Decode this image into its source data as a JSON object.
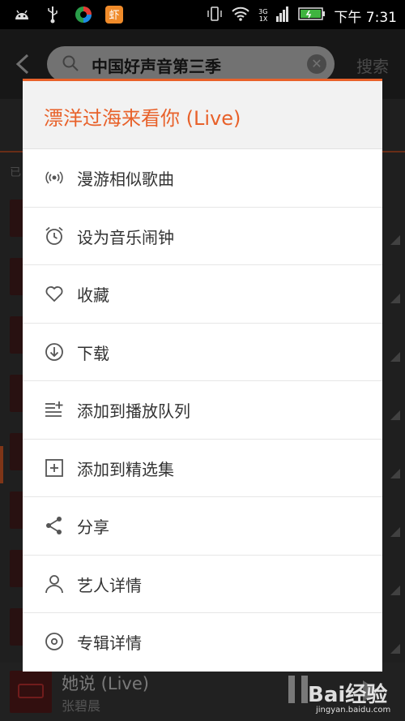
{
  "status_bar": {
    "time": "下午 7:31",
    "network_top": "3G",
    "network_bottom": "1X",
    "icons": [
      "android-icon",
      "usb-icon",
      "app-icon",
      "xiami-icon",
      "vibrate-icon",
      "wifi-icon",
      "signal-icon",
      "battery-icon"
    ]
  },
  "search": {
    "query": "中国好声音第三季",
    "button_label": "搜索"
  },
  "background_list": {
    "tab_label": "已"
  },
  "dialog": {
    "title": "漂洋过海来看你 (Live)",
    "accent_color": "#e8612a",
    "menu": [
      {
        "label": "漫游相似歌曲",
        "icon": "radio-icon"
      },
      {
        "label": "设为音乐闹钟",
        "icon": "alarm-icon"
      },
      {
        "label": "收藏",
        "icon": "heart-icon"
      },
      {
        "label": "下载",
        "icon": "download-icon"
      },
      {
        "label": "添加到播放队列",
        "icon": "queue-add-icon"
      },
      {
        "label": "添加到精选集",
        "icon": "collection-add-icon"
      },
      {
        "label": "分享",
        "icon": "share-icon"
      },
      {
        "label": "艺人详情",
        "icon": "person-icon"
      },
      {
        "label": "专辑详情",
        "icon": "album-icon"
      }
    ]
  },
  "player": {
    "song": "她说 (Live)",
    "artist": "张碧晨"
  },
  "watermark": {
    "logo": "Bai经验",
    "url": "jingyan.baidu.com"
  }
}
